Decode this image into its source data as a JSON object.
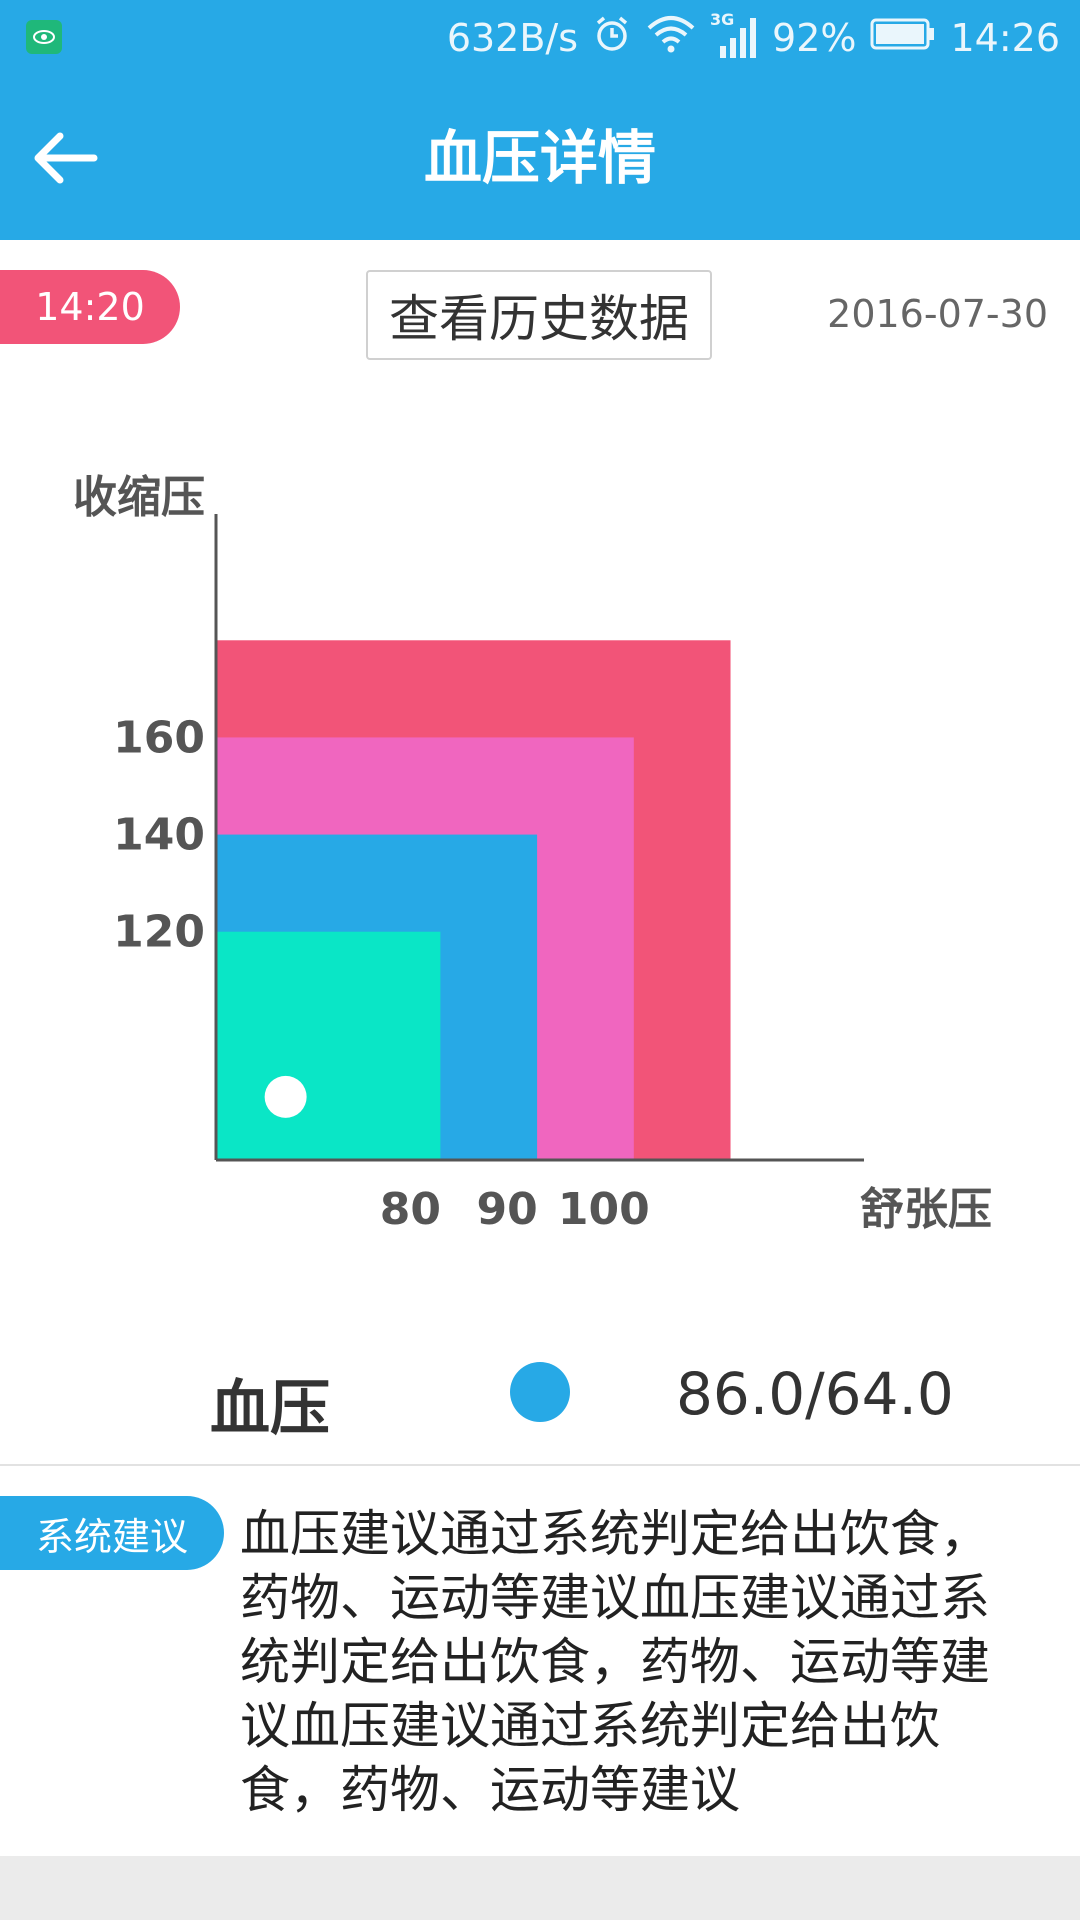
{
  "status_bar": {
    "speed": "632B/s",
    "battery_percent": "92%",
    "time": "14:26",
    "network_label": "3G",
    "icons": [
      "eye-icon",
      "alarm-icon",
      "wifi-icon",
      "signal-icon",
      "battery-icon"
    ]
  },
  "toolbar": {
    "title": "血压详情",
    "back_icon": "arrow-left-icon"
  },
  "record": {
    "time": "14:20",
    "history_button": "查看历史数据",
    "date": "2016-07-30"
  },
  "chart_data": {
    "type": "scatter",
    "ylabel": "收缩压",
    "xlabel": "舒张压",
    "x_ticks": [
      80,
      90,
      100
    ],
    "y_ticks": [
      120,
      140,
      160
    ],
    "zones": [
      {
        "x_max": 110,
        "y_max": 180,
        "color": "#f25478"
      },
      {
        "x_max": 100,
        "y_max": 160,
        "color": "#f066bf"
      },
      {
        "x_max": 90,
        "y_max": 140,
        "color": "#27a9e6"
      },
      {
        "x_max": 80,
        "y_max": 120,
        "color": "#0ae6c6"
      }
    ],
    "points": [
      {
        "x": 64.0,
        "y": 86.0,
        "color": "#ffffff"
      }
    ],
    "xlim": [
      56.8,
      123.8
    ],
    "ylim": [
      73.0,
      206.0
    ]
  },
  "legend": {
    "label": "血压",
    "dot_color": "#27a9e6",
    "value": "86.0/64.0"
  },
  "advice": {
    "tag": "系统建议",
    "text": "血压建议通过系统判定给出饮食，药物、运动等建议血压建议通过系统判定给出饮食，药物、运动等建议血压建议通过系统判定给出饮食，药物、运动等建议"
  }
}
